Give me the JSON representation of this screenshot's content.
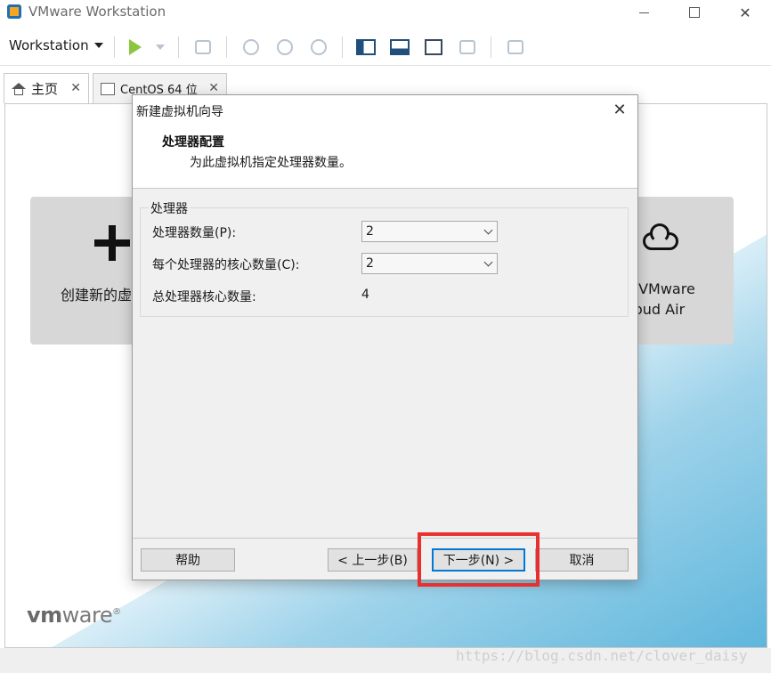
{
  "window": {
    "title": "VMware Workstation",
    "close_glyph": "✕"
  },
  "toolbar": {
    "workstation_menu": "Workstation"
  },
  "tabs": [
    {
      "label": "主页",
      "close": "✕"
    },
    {
      "label": "CentOS 64 位",
      "close": "✕"
    }
  ],
  "home": {
    "create_label": "创建新的虚",
    "cloud_label": " VMware\noud Air",
    "logo_prefix": "vm",
    "logo_suffix": "ware",
    "logo_mark": "®"
  },
  "watermark": "https://blog.csdn.net/clover_daisy",
  "dialog": {
    "title": "新建虚拟机向导",
    "close_glyph": "✕",
    "heading": "处理器配置",
    "subheading": "为此虚拟机指定处理器数量。",
    "group_label": "处理器",
    "fields": {
      "processor_count_label": "处理器数量(P):",
      "processor_count_value": "2",
      "cores_label": "每个处理器的核心数量(C):",
      "cores_value": "2",
      "total_label": "总处理器核心数量:",
      "total_value": "4"
    },
    "buttons": {
      "help": "帮助",
      "back": "< 上一步(B)",
      "next": "下一步(N) >",
      "cancel": "取消"
    }
  },
  "colors": {
    "highlight": "#e8312f",
    "accent": "#0078d7",
    "play": "#8cc63f"
  }
}
